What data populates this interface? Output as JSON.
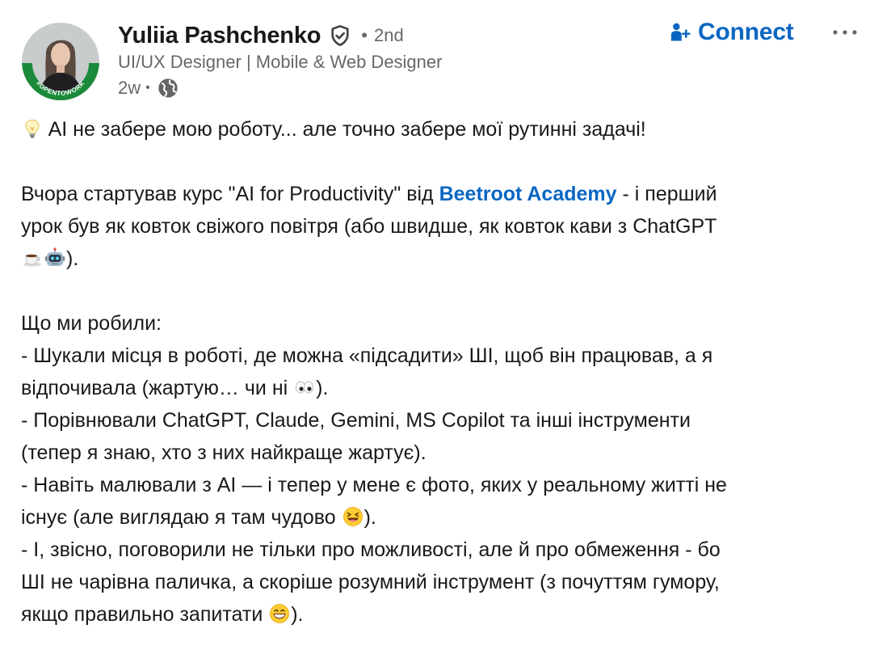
{
  "author": {
    "name": "Yuliia Pashchenko",
    "degree_separator": "•",
    "degree": "2nd",
    "headline": "UI/UX Designer | Mobile & Web Designer",
    "time_ago": "2w",
    "meta_separator": "•",
    "avatar_badge": "#OPENTOWORK"
  },
  "actions": {
    "connect_label": "Connect",
    "more_label": "···"
  },
  "colors": {
    "link": "#0a66c2",
    "open_to_work": "#1b8a3a"
  },
  "icons": {
    "verified": "verified-shield-icon",
    "globe": "globe-icon",
    "connect": "add-person-icon",
    "more": "ellipsis-icon"
  },
  "post": {
    "line1": "AI не забере мою роботу... але точно забере мої рутинні задачі!",
    "line2_prefix": "Вчора стартував курс \"AI for Productivity\" від ",
    "mention": "Beetroot Academy",
    "line2_suffix": " - і перший",
    "line3": "урок був як ковток свіжого повітря (або швидше, як ковток кави з ChatGPT",
    "line4_suffix": ").",
    "line5": "Що ми робили:",
    "line6": " - Шукали місця в роботі, де можна «підсадити» ШІ, щоб він працював, а я",
    "line7_prefix": "відпочивала (жартую… чи ні ",
    "line7_suffix": ").",
    "line8": " - Порівнювали ChatGPT, Claude, Gemini, MS Copilot та інші інструменти",
    "line9": "(тепер я знаю, хто з них найкраще жартує).",
    "line10": " - Навіть малювали з AI — і тепер у мене є фото, яких у реальному житті не",
    "line11_prefix": "існує (але виглядаю я там чудово ",
    "line11_suffix": ").",
    "line12": " - І, звісно, поговорили не тільки про можливості, але й про обмеження - бо",
    "line13": "ШІ не чарівна паличка, а скоріше розумний інструмент (з почуттям гумору,",
    "line14_prefix": "якщо правильно запитати ",
    "line14_suffix": ")."
  },
  "emojis": {
    "bulb": "light-bulb-emoji",
    "coffee": "coffee-emoji",
    "robot": "robot-emoji",
    "eyes": "eyes-emoji",
    "laughing": "laughing-emoji",
    "grin": "grinning-emoji"
  }
}
